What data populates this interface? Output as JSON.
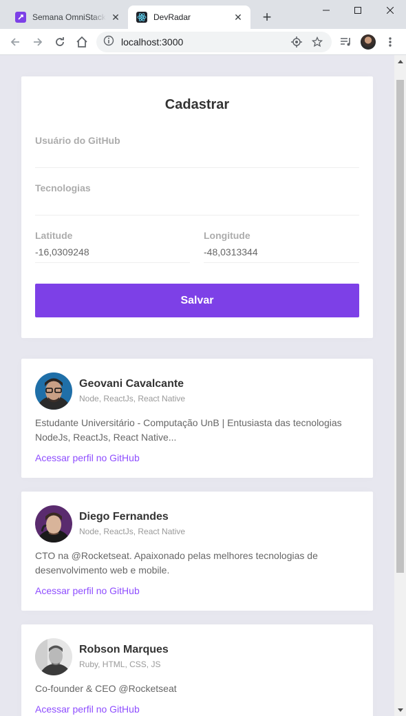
{
  "browser": {
    "tabs": [
      {
        "title": "Semana OmniStack | Rocketseat",
        "close_glyph": "✕"
      },
      {
        "title": "DevRadar",
        "close_glyph": "✕"
      }
    ],
    "new_tab_glyph": "+",
    "url": "localhost:3000",
    "icons": [
      "back-arrow-icon",
      "forward-arrow-icon",
      "reload-icon",
      "home-icon",
      "info-icon",
      "location-icon",
      "star-icon",
      "media-control-icon",
      "profile-avatar",
      "menu-icon"
    ]
  },
  "form": {
    "title": "Cadastrar",
    "github_label": "Usuário do GitHub",
    "github_value": "",
    "techs_label": "Tecnologias",
    "techs_value": "",
    "latitude_label": "Latitude",
    "latitude_value": "-16,0309248",
    "longitude_label": "Longitude",
    "longitude_value": "-48,0313344",
    "save_label": "Salvar"
  },
  "devs": [
    {
      "name": "Geovani Cavalcante",
      "techs": "Node, ReactJs, React Native",
      "bio": "Estudante Universitário - Computação UnB | Entusiasta das tecnologias NodeJs, ReactJs, React Native...",
      "link": "Acessar perfil no GitHub"
    },
    {
      "name": "Diego Fernandes",
      "techs": "Node, ReactJs, React Native",
      "bio": "CTO na @Rocketseat. Apaixonado pelas melhores tecnologias de desenvolvimento web e mobile.",
      "link": "Acessar perfil no GitHub"
    },
    {
      "name": "Robson Marques",
      "techs": "Ruby, HTML, CSS, JS",
      "bio": "Co-founder & CEO @Rocketseat",
      "link": "Acessar perfil no GitHub"
    }
  ],
  "colors": {
    "accent": "#7d40e7",
    "link": "#8e4dff",
    "background": "#e7e7ef"
  }
}
